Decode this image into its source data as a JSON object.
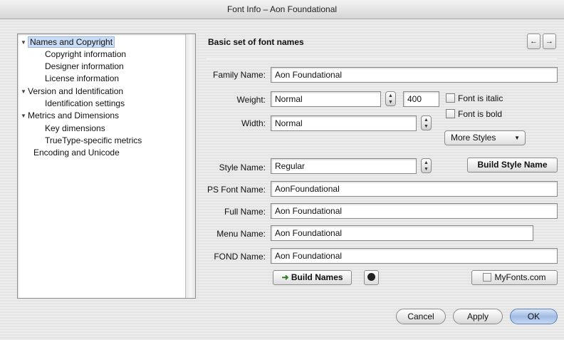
{
  "window": {
    "title": "Font Info – Aon Foundational"
  },
  "sidebar": {
    "items": [
      {
        "label": "Names and Copyright",
        "expanded": true,
        "selected": true,
        "level": 0
      },
      {
        "label": "Copyright information",
        "level": 1
      },
      {
        "label": "Designer information",
        "level": 1
      },
      {
        "label": "License information",
        "level": 1
      },
      {
        "label": "Version and Identification",
        "expanded": true,
        "level": 0
      },
      {
        "label": "Identification settings",
        "level": 1
      },
      {
        "label": "Metrics and Dimensions",
        "expanded": true,
        "level": 0
      },
      {
        "label": "Key dimensions",
        "level": 1
      },
      {
        "label": "TrueType-specific metrics",
        "level": 1
      },
      {
        "label": "Encoding and Unicode",
        "level": 0
      }
    ]
  },
  "panel": {
    "title": "Basic set of font names",
    "prev_icon": "left-arrow-icon",
    "next_icon": "right-arrow-icon"
  },
  "form": {
    "family_label": "Family Name:",
    "family_value": "Aon Foundational",
    "weight_label": "Weight:",
    "weight_value": "Normal",
    "weight_number": "400",
    "italic_label": "Font is italic",
    "italic_checked": false,
    "bold_label": "Font is bold",
    "bold_checked": false,
    "width_label": "Width:",
    "width_value": "Normal",
    "more_styles_label": "More Styles",
    "style_label": "Style Name:",
    "style_value": "Regular",
    "build_style_label": "Build Style Name",
    "ps_label": "PS Font Name:",
    "ps_value": "AonFoundational",
    "full_label": "Full Name:",
    "full_value": "Aon Foundational",
    "menu_label": "Menu Name:",
    "menu_value": "Aon Foundational",
    "fond_label": "FOND Name:",
    "fond_value": "Aon Foundational",
    "build_names_label": "Build Names",
    "myfonts_label": "MyFonts.com"
  },
  "footer": {
    "cancel_label": "Cancel",
    "apply_label": "Apply",
    "ok_label": "OK"
  },
  "colors": {
    "selection": "#c9dcf5",
    "default_button": "#9fbbe3"
  }
}
